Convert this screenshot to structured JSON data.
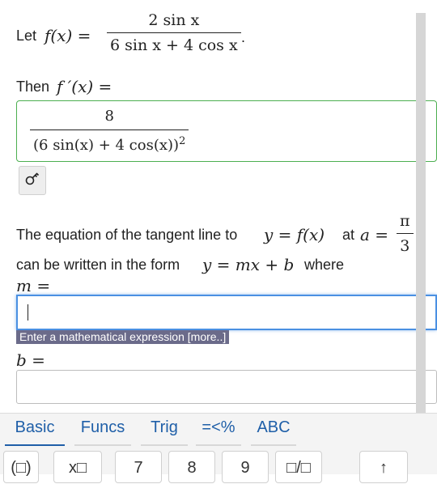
{
  "question": {
    "let_text": "Let",
    "f_lhs": "f(x) =",
    "f_num": "2 sin x",
    "f_den": "6 sin x + 4 cos x",
    "period": ".",
    "then_text": "Then",
    "fprime_lhs": "f ′(x) =",
    "answer_num": "8",
    "answer_den": "(6 sin(x) + 4 cos(x))",
    "answer_exp": "2",
    "tangent_text": "The equation of the tangent line to",
    "tangent_y_eq": "y = f(x)",
    "at_text": "at",
    "a_eq": "a =",
    "a_num": "π",
    "a_den": "3",
    "form_text_1": "can be written in the form",
    "form_eq": "y = mx + b",
    "form_text_2": "where",
    "m_label": "m =",
    "m_value": "",
    "tooltip": "Enter a mathematical expression [more..]",
    "b_label": "b =",
    "b_value": ""
  },
  "icons": {
    "key_icon": "key-icon"
  },
  "keyboard": {
    "tabs": [
      "Basic",
      "Funcs",
      "Trig",
      "=<%",
      "ABC"
    ],
    "active_tab": "Basic",
    "keys": [
      "(□)",
      "x□",
      "7",
      "8",
      "9",
      "□/□",
      "↑"
    ]
  }
}
